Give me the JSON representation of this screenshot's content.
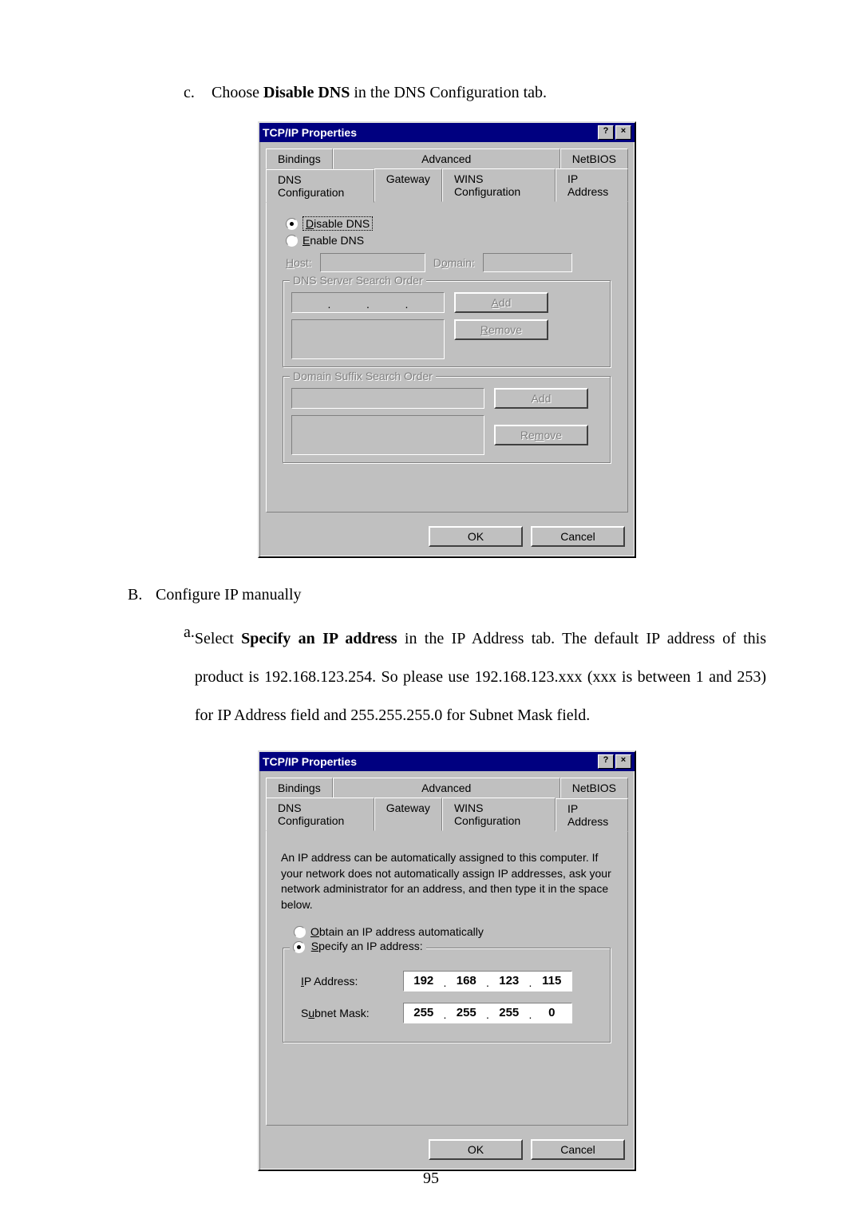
{
  "step_c": {
    "letter": "c.",
    "text_before": "Choose ",
    "bold": "Disable DNS",
    "text_after": " in the DNS Configuration tab."
  },
  "dialog1": {
    "title": "TCP/IP Properties",
    "help_btn": "?",
    "close_btn": "×",
    "tabs_back": [
      "Bindings",
      "Advanced",
      "NetBIOS"
    ],
    "tabs_front": [
      "DNS Configuration",
      "Gateway",
      "WINS Configuration",
      "IP Address"
    ],
    "radio_disable": "Disable DNS",
    "radio_enable": "Enable DNS",
    "host_label": "Host:",
    "domain_label": "Domain:",
    "dns_order_label": "DNS Server Search Order",
    "suffix_order_label": "Domain Suffix Search Order",
    "add_btn": "Add",
    "remove_btn": "Remove",
    "ok_btn": "OK",
    "cancel_btn": "Cancel"
  },
  "section_B": {
    "letter": "B.",
    "text": "Configure IP manually"
  },
  "step_a": {
    "letter": "a.",
    "line1_pre": "Select ",
    "line1_bold": "Specify an IP address",
    "line1_post": " in the IP Address tab. The default IP address of this",
    "line2": "product is 192.168.123.254. So please use 192.168.123.xxx (xxx is between 1 and 253) for IP Address field and 255.255.255.0 for Subnet Mask field."
  },
  "dialog2": {
    "title": "TCP/IP Properties",
    "help_btn": "?",
    "close_btn": "×",
    "tabs_back": [
      "Bindings",
      "Advanced",
      "NetBIOS"
    ],
    "tabs_front": [
      "DNS Configuration",
      "Gateway",
      "WINS Configuration",
      "IP Address"
    ],
    "info": "An IP address can be automatically assigned to this computer. If your network does not automatically assign IP addresses, ask your network administrator for an address, and then type it in the space below.",
    "radio_obtain": "Obtain an IP address automatically",
    "radio_specify": "Specify an IP address:",
    "ip_label": "IP Address:",
    "ip_value": [
      "192",
      "168",
      "123",
      "115"
    ],
    "subnet_label": "Subnet Mask:",
    "subnet_value": [
      "255",
      "255",
      "255",
      "0"
    ],
    "ok_btn": "OK",
    "cancel_btn": "Cancel"
  },
  "page_number": "95"
}
